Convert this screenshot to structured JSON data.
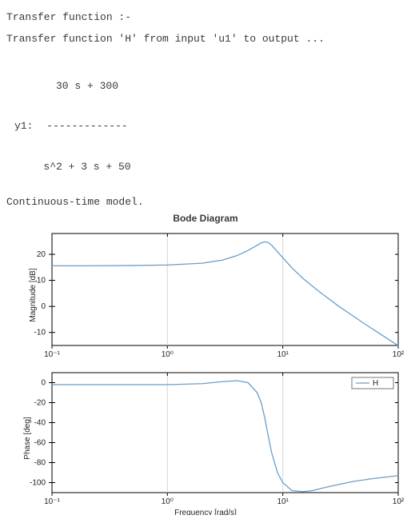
{
  "text": {
    "heading": "Transfer function :-",
    "desc": "Transfer function 'H' from input 'u1' to output ...",
    "tf_numerator": "30 s + 300",
    "tf_divider": "-------------",
    "tf_label": "y1:",
    "tf_denominator": "s^2 + 3 s + 50",
    "ct": "Continuous-time model.",
    "title": "Bode Diagram",
    "mag_label": "Magnitude [dB]",
    "phase_label": "Phase [deg]",
    "xlabel_cut": "Frequency [rad/s]"
  },
  "chart_data": [
    {
      "type": "line",
      "title": "Bode Diagram",
      "ylabel": "Magnitude [dB]",
      "xlabel": "",
      "xscale": "log",
      "xlim": [
        0.1,
        100
      ],
      "ylim": [
        -15,
        28
      ],
      "yticks": [
        -10,
        0,
        10,
        20
      ],
      "xticks": [
        0.1,
        1,
        10,
        100
      ],
      "xtick_labels": [
        "10⁻¹",
        "10⁰",
        "10¹",
        "10²"
      ],
      "series": [
        {
          "name": "H",
          "x": [
            0.1,
            0.2,
            0.5,
            1,
            2,
            3,
            4,
            5,
            6,
            6.5,
            7,
            7.5,
            8,
            9,
            10,
            12,
            15,
            20,
            30,
            50,
            70,
            100
          ],
          "values": [
            15.6,
            15.6,
            15.7,
            15.9,
            16.6,
            17.8,
            19.5,
            21.5,
            23.5,
            24.4,
            24.8,
            24.5,
            23.5,
            21.0,
            18.7,
            14.8,
            10.7,
            6.2,
            0.3,
            -6.4,
            -10.6,
            -15.1
          ]
        }
      ]
    },
    {
      "type": "line",
      "title": "",
      "ylabel": "Phase [deg]",
      "xlabel": "Frequency [rad/s]",
      "xscale": "log",
      "xlim": [
        0.1,
        100
      ],
      "ylim": [
        -110,
        10
      ],
      "yticks": [
        -100,
        -80,
        -60,
        -40,
        -20,
        0
      ],
      "xticks": [
        0.1,
        1,
        10,
        100
      ],
      "xtick_labels": [
        "10⁻¹",
        "10⁰",
        "10¹",
        "10²"
      ],
      "legend_position": "right",
      "series": [
        {
          "name": "H",
          "x": [
            0.1,
            0.3,
            0.6,
            1,
            2,
            3,
            4,
            5,
            6,
            6.5,
            7,
            7.5,
            8,
            9,
            10,
            12,
            15,
            18,
            25,
            40,
            60,
            100
          ],
          "values": [
            -2,
            -2,
            -2,
            -2,
            -1,
            1,
            2,
            0,
            -10,
            -20,
            -36,
            -54,
            -70,
            -90,
            -100,
            -108,
            -109,
            -108,
            -104,
            -99,
            -96,
            -93
          ]
        }
      ]
    }
  ]
}
